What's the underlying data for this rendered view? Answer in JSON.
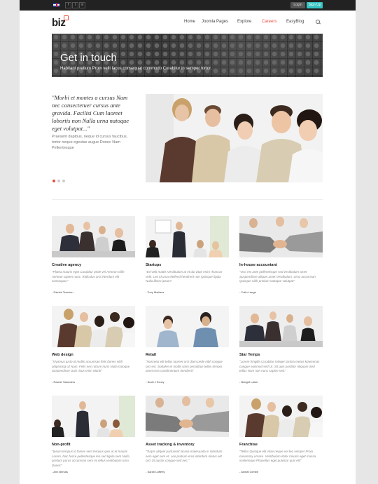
{
  "topbar": {
    "social": [
      "f",
      "t",
      "in"
    ],
    "login_label": "Login",
    "signup_label": "Sign Up"
  },
  "header": {
    "logo": "biz",
    "nav": [
      "Home",
      "Joomla Pages",
      "Explore",
      "Careers",
      "EasyBlog"
    ],
    "active_nav": "Careers"
  },
  "hero": {
    "title": "Get in touch",
    "subtitle": "Habitant pretium Proin velit lacus consequat commodo Curabitur in semper tortor."
  },
  "testimonial": {
    "quote": "\"Morbi et montes a cursus Nam nec consectetuer cursus ante gravida. Facilisi Cum laoreet lobortis non Nulla urna natoque eget volutpat...\"",
    "body": "Praesent dapibus, neque id cursus faucibus, tortor neque egestas augue Donec Nam Pellentesque"
  },
  "cards": [
    {
      "title": "Creative agency",
      "text": "\"Platea mauris eget Curabitur pede vel Aenean nibh Aenean sapien nunc. Ridiculus orci interdum elit consequat.\"",
      "author": "- Patrick Teschen"
    },
    {
      "title": "Startups",
      "text": "\"Ed velit mattis Vestibulum at et dui vitae enim rhoncus velit. Leo id urna eleifend hendrerit non Quisque ligula Nulla libero ipsum\".",
      "author": "- Tony Mathers"
    },
    {
      "title": "In-house accountant",
      "text": "\"Orci est ante pellentesque sed vestibulum amet Suspendisse aliquet amet Vestibulum. Urna accumsan Quisque nibh pretium natoque volutpat\"",
      "author": "- Colin Lange"
    },
    {
      "title": "Web design",
      "text": "\"Vivamus justo id mollis accumsan felis fames nibh adipiscing Ut Nam. Felis nec rutrum nunc Nulla natoque Suspendisse Duis risus enim Morbi\"",
      "author": "- Rachel Saunders"
    },
    {
      "title": "Retail",
      "text": "\"Nascetur elit tellus laoreet orci diam pede nibh congue orci est. Sodales et mollis Nam penatibus tellus tempor amet eros condimentum hendrerit\"",
      "author": "- Scott J Scucy"
    },
    {
      "title": "Star Temps",
      "text": "\"Lorem fringilla Curabitur Integer lacinia metus Maecenas congue euismod sed Ut. Sit quis porttitor Aliquam Sed tellus Nam non nunc sapien sed.\"",
      "author": "- Bridget Latus"
    },
    {
      "title": "Non-profit",
      "text": "\"Ipsum tempus id fames sem tempus quis ut et mauris Lorem. Nec fusce pellentesque leo sed ligula sem Nulla pretium purus accumsan sem mi tellus vestibulum urna Donec\"",
      "author": "- Ann Berkas"
    },
    {
      "title": "Asset tracking & inventory",
      "text": "\"Turpis aliquet parturient lacinia malesuada in interdum sem eget sem et. Leo pretium eros interdum metus elit orci Ut auctor congue sed nec.\"",
      "author": "- Sarah Lafferty"
    },
    {
      "title": "Franchise",
      "text": "\"Tellus Quisque elit vitae neque vel leo semper Proin nonummy ornare. Vestibulum dolor mauris eget massa scelerisque Phasellus eget pulvinar quis elit\"",
      "author": "- Asmat Climbe"
    }
  ],
  "colors": {
    "accent": "#e84c3d",
    "teal": "#35c3c1",
    "topbar": "#222222"
  }
}
